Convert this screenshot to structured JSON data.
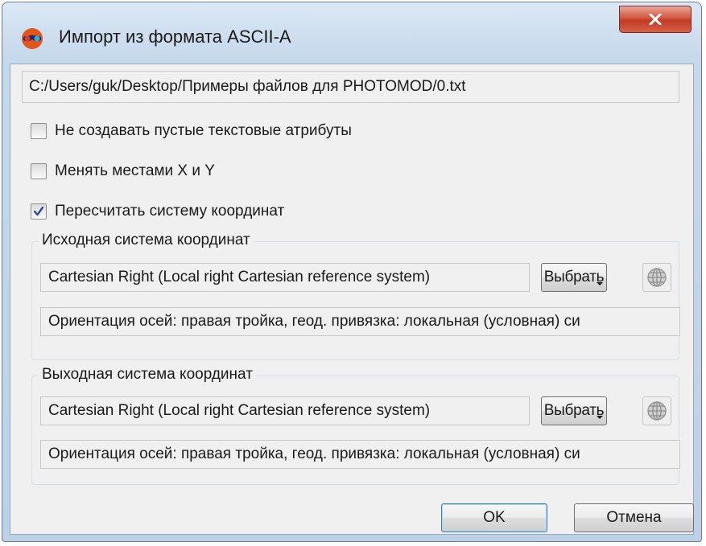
{
  "window": {
    "title": "Импорт из формата ASCII-A",
    "close_icon": "close-x-icon"
  },
  "file_path": "C:/Users/guk/Desktop/Примеры файлов для PHOTOMOD/0.txt",
  "options": [
    {
      "label": "Не создавать пустые текстовые атрибуты",
      "checked": false
    },
    {
      "label": "Менять местами X и Y",
      "checked": false
    },
    {
      "label": "Пересчитать систему координат",
      "checked": true
    }
  ],
  "source_cs": {
    "title": "Исходная система координат",
    "name": "Cartesian Right (Local right Cartesian reference system)",
    "choose_label": "Выбрать",
    "description": "Ориентация осей: правая тройка, геод. привязка: локальная (условная) си",
    "globe_icon": "globe-icon"
  },
  "target_cs": {
    "title": "Выходная система координат",
    "name": "Cartesian Right (Local right Cartesian reference system)",
    "choose_label": "Выбрать",
    "description": "Ориентация осей: правая тройка, геод. привязка: локальная (условная) си",
    "globe_icon": "globe-icon"
  },
  "buttons": {
    "ok": "OK",
    "cancel": "Отмена"
  },
  "colors": {
    "titlebar": "#c6d8ec",
    "close_button": "#c23a23",
    "client_bg": "#f0f0f0",
    "default_button_border": "#3c7fb1",
    "check_mark": "#2a4a9a"
  }
}
